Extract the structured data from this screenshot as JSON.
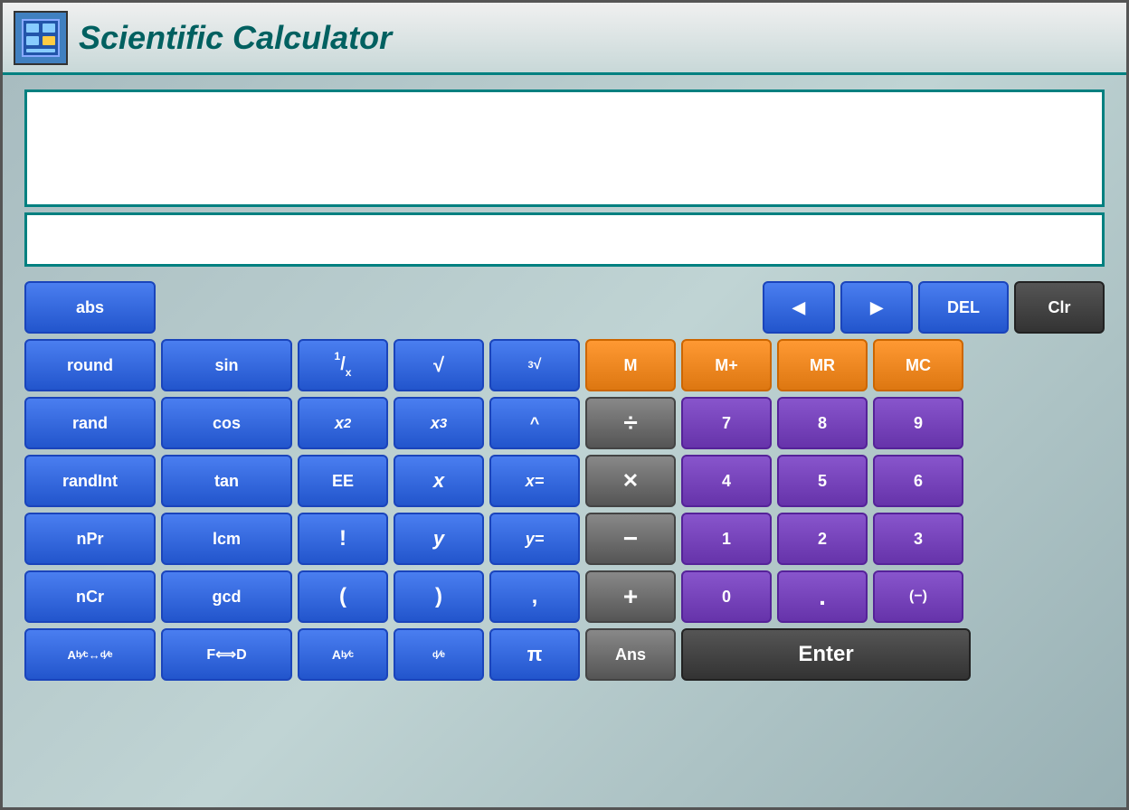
{
  "title": "Scientific Calculator",
  "display": {
    "main_value": "",
    "secondary_value": ""
  },
  "buttons": {
    "row0": {
      "abs": "abs",
      "left_arrow": "◀",
      "right_arrow": "▶",
      "del": "DEL",
      "clr": "Clr"
    },
    "row1": {
      "round": "round",
      "sin": "sin",
      "inv_x": "¹⁄ₓ",
      "sqrt": "√",
      "cbrt": "³√",
      "M": "M",
      "Mplus": "M+",
      "MR": "MR",
      "MC": "MC"
    },
    "row2": {
      "rand": "rand",
      "cos": "cos",
      "x2": "x²",
      "x3": "x³",
      "caret": "^",
      "divide": "÷",
      "n7": "7",
      "n8": "8",
      "n9": "9"
    },
    "row3": {
      "randInt": "randInt",
      "tan": "tan",
      "EE": "EE",
      "x_var": "x",
      "x_eq": "x=",
      "multiply": "×",
      "n4": "4",
      "n5": "5",
      "n6": "6"
    },
    "row4": {
      "nPr": "nPr",
      "lcm": "lcm",
      "factorial": "!",
      "y_var": "y",
      "y_eq": "y=",
      "minus": "−",
      "n1": "1",
      "n2": "2",
      "n3": "3"
    },
    "row5": {
      "nCr": "nCr",
      "gcd": "gcd",
      "lparen": "(",
      "rparen": ")",
      "comma": ",",
      "plus": "+",
      "n0": "0",
      "dot": ".",
      "neg": "(−)"
    },
    "row6": {
      "frac_conv": "A^b/c ↔ d/e",
      "f_to_d": "F↔D",
      "A_frac": "A^b/c",
      "d_e": "d/e",
      "pi": "π",
      "ans": "Ans",
      "enter": "Enter"
    }
  }
}
